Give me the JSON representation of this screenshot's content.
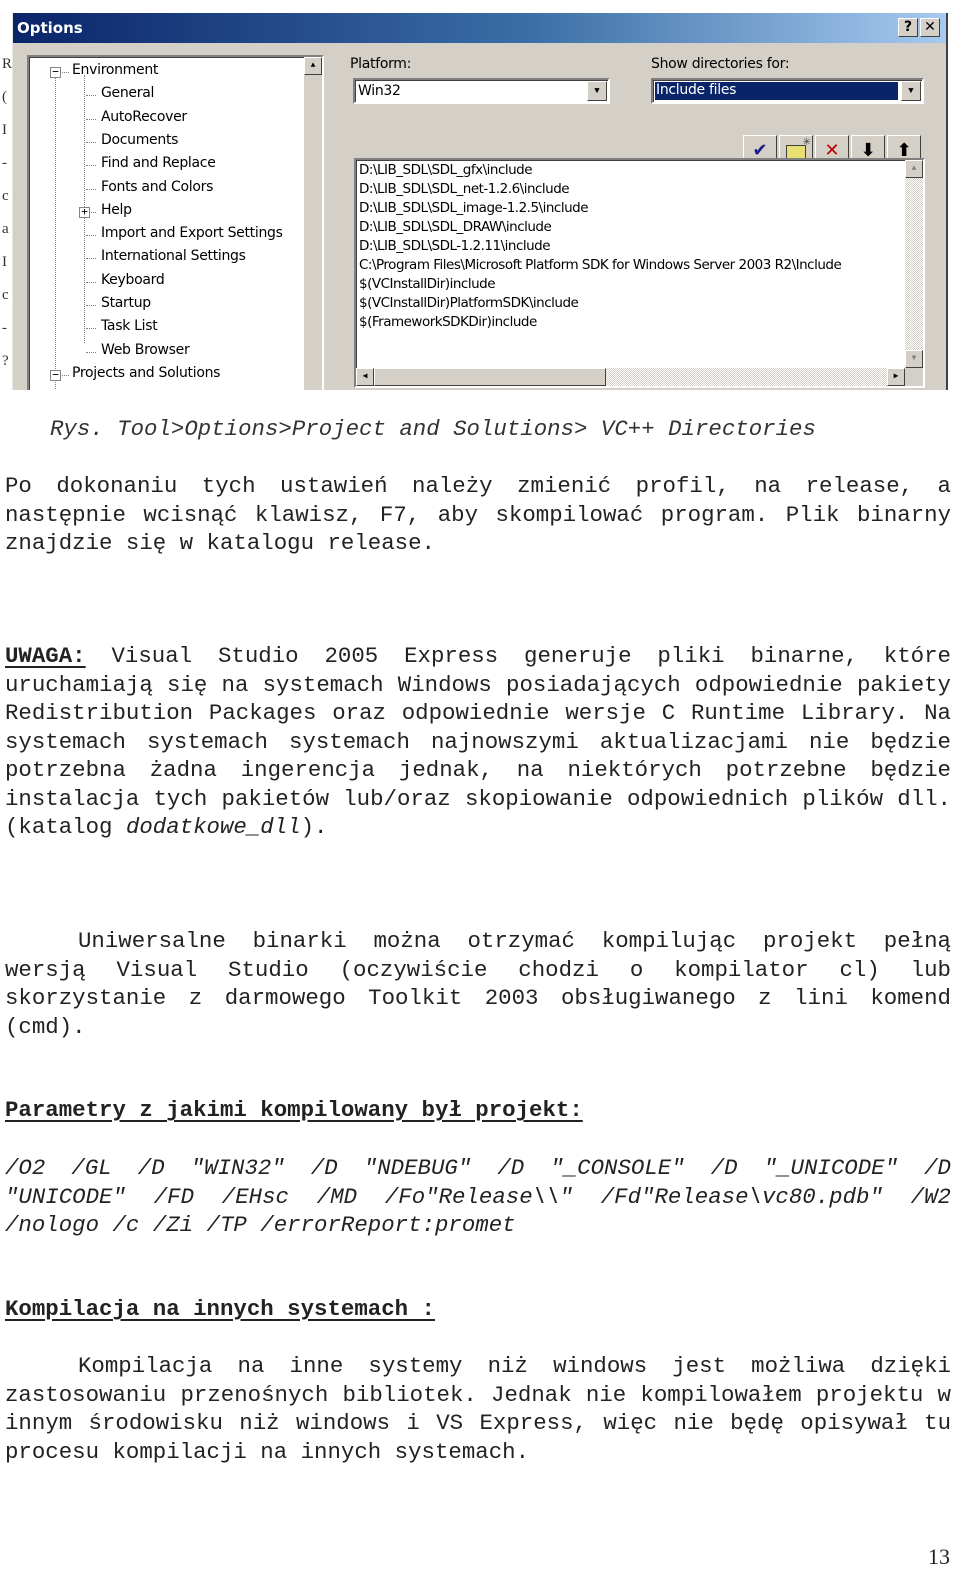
{
  "screenshot": {
    "dialog_title": "Options",
    "help_button": "?",
    "close_button": "✕",
    "tree": [
      {
        "label": "Environment",
        "level": 0,
        "expander": "−"
      },
      {
        "label": "General",
        "level": 1
      },
      {
        "label": "AutoRecover",
        "level": 1
      },
      {
        "label": "Documents",
        "level": 1
      },
      {
        "label": "Find and Replace",
        "level": 1
      },
      {
        "label": "Fonts and Colors",
        "level": 1
      },
      {
        "label": "Help",
        "level": 1,
        "expander": "+"
      },
      {
        "label": "Import and Export Settings",
        "level": 1
      },
      {
        "label": "International Settings",
        "level": 1
      },
      {
        "label": "Keyboard",
        "level": 1
      },
      {
        "label": "Startup",
        "level": 1
      },
      {
        "label": "Task List",
        "level": 1
      },
      {
        "label": "Web Browser",
        "level": 1
      },
      {
        "label": "Projects and Solutions",
        "level": 0,
        "expander": "−"
      }
    ],
    "platform_label": "Platform:",
    "platform_value": "Win32",
    "show_dirs_label": "Show directories for:",
    "show_dirs_value": "Include files",
    "toolbar": [
      {
        "name": "check-icon",
        "glyph": "✔",
        "color": "#1a1a8c"
      },
      {
        "name": "new-folder-icon",
        "glyph": "",
        "color": "#e8e070"
      },
      {
        "name": "delete-icon",
        "glyph": "✕",
        "color": "#c00000"
      },
      {
        "name": "arrow-down-icon",
        "glyph": "⬇",
        "color": "#000000"
      },
      {
        "name": "arrow-up-icon",
        "glyph": "⬆",
        "color": "#000000"
      }
    ],
    "directories": [
      "D:\\LIB_SDL\\SDL_gfx\\include",
      "D:\\LIB_SDL\\SDL_net-1.2.6\\include",
      "D:\\LIB_SDL\\SDL_image-1.2.5\\include",
      "D:\\LIB_SDL\\SDL_DRAW\\include",
      "D:\\LIB_SDL\\SDL-1.2.11\\include",
      "C:\\Program Files\\Microsoft Platform SDK for Windows Server 2003 R2\\Include",
      "$(VCInstallDir)include",
      "$(VCInstallDir)PlatformSDK\\include",
      "$(FrameworkSDKDir)include"
    ],
    "edge_fragments": [
      "R",
      "(",
      "I",
      "-",
      "c",
      "a",
      "I",
      "c",
      "-",
      "?"
    ]
  },
  "caption": "Rys. Tool>Options>Project and Solutions> VC++ Directories",
  "para1": "Po dokonaniu tych ustawień należy zmienić profil, na release, a następnie wcisnąć klawisz, F7, aby skompilować program. Plik binarny znajdzie się w katalogu release.",
  "warning": {
    "label": "UWAGA:",
    "text": " Visual Studio 2005 Express generuje pliki binarne, które uruchamiają się na systemach Windows posiadających odpowiednie pakiety Redistribution Packages oraz odpowiednie wersje C Runtime Library. Na systemach systemach systemach najnowszymi aktualizacjami nie będzie potrzebna żadna ingerencja jednak, na niektórych potrzebne będzie instalacja tych pakietów lub/oraz skopiowanie odpowiednich plików dll. (katalog ",
    "italic": "dodatkowe_dll",
    "tail": ")."
  },
  "para2": "Uniwersalne binarki można otrzymać kompilując projekt pełną wersją Visual Studio (oczywiście chodzi o kompilator cl) lub skorzystanie z darmowego Toolkit 2003 obsługiwanego z lini komend (cmd).",
  "params_heading": "Parametry z jakimi kompilowany był projekt:",
  "params_text": "/O2 /GL /D \"WIN32\" /D \"NDEBUG\" /D \"_CONSOLE\" /D \"_UNICODE\" /D \"UNICODE\" /FD /EHsc /MD /Fo\"Release\\\\\" /Fd\"Release\\vc80.pdb\" /W2 /nologo /c /Zi /TP /errorReport:promet",
  "other_heading": "Kompilacja na innych systemach :",
  "para3": "Kompilacja na inne systemy niż windows jest możliwa dzięki zastosowaniu przenośnych bibliotek. Jednak nie kompilowałem projektu w innym środowisku niż windows i VS Express, więc nie będę opisywał tu procesu kompilacji na innych systemach.",
  "page_number": "13"
}
